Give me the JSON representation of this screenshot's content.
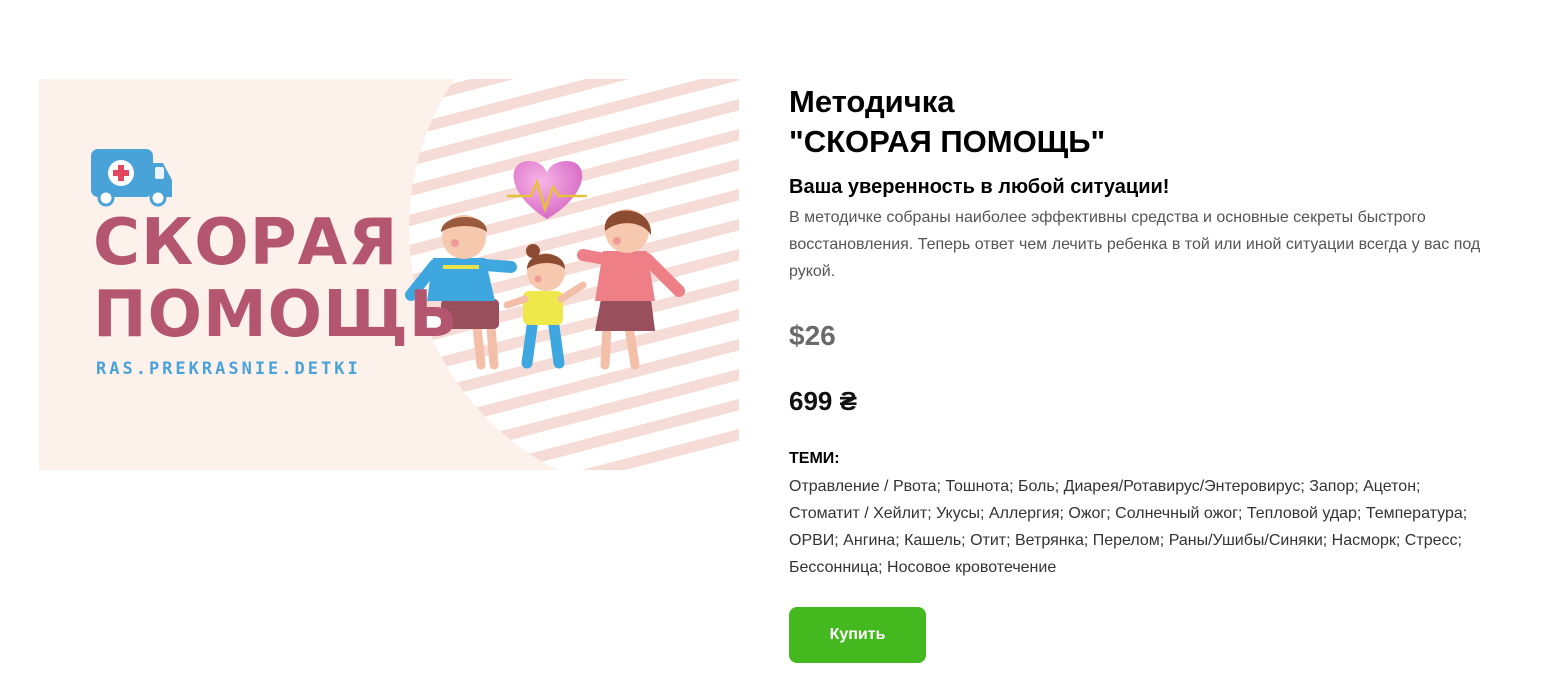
{
  "banner": {
    "title": "СКОРАЯ\nПОМОЩЬ",
    "url": "RAS.PREKRASNIE.DETKI"
  },
  "product": {
    "title": "Методичка\n\"СКОРАЯ ПОМОЩЬ\"",
    "subtitle": "Ваша уверенность в любой ситуации!",
    "description": "В методичке собраны наиболее эффективны средства и основные секреты быстрого восстановления. Теперь ответ чем лечить ребенка в той или иной ситуации всегда у вас под рукой.",
    "price_usd": "$26",
    "price_uah": "699 ₴",
    "topics_heading": "ТЕМИ:",
    "topics": "Отравление / Рвота; Тошнота; Боль; Диарея/Ротавирус/Энтеровирус; Запор; Ацетон; Стоматит / Хейлит; Укусы; Аллергия; Ожог; Солнечный ожог; Тепловой удар; Температура; ОРВИ; Ангина; Кашель; Отит; Ветрянка; Перелом; Раны/Ушибы/Синяки; Насморк; Стресс; Бессонница; Носовое кровотечение",
    "buy_label": "Купить"
  },
  "colors": {
    "banner_bg": "#fdf1ec",
    "brand_pink": "#b4566f",
    "brand_blue": "#4aa3d8",
    "buy_button": "#44b91f"
  },
  "icons": [
    "ambulance-icon",
    "heart-pulse-icon"
  ]
}
